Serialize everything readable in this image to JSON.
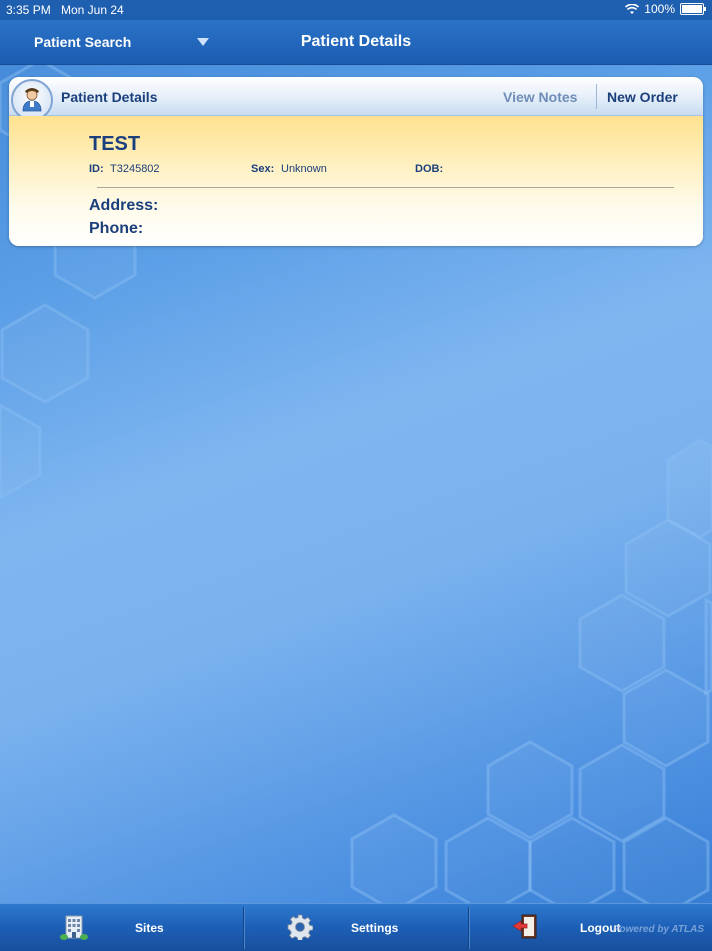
{
  "status_bar": {
    "time": "3:35 PM",
    "date": "Mon Jun 24",
    "battery": "100%",
    "battery_level": 1.0
  },
  "nav": {
    "left_label": "Patient Search",
    "title": "Patient Details"
  },
  "card": {
    "header_title": "Patient Details",
    "view_notes_label": "View Notes",
    "new_order_label": "New Order",
    "patient_name": "TEST",
    "id_label": "ID:",
    "id_value": "T3245802",
    "sex_label": "Sex:",
    "sex_value": "Unknown",
    "dob_label": "DOB:",
    "dob_value": "",
    "address_label": "Address:",
    "phone_label": "Phone:"
  },
  "tabs": [
    {
      "label": "Sites",
      "icon": "building-icon"
    },
    {
      "label": "Settings",
      "icon": "gear-icon"
    },
    {
      "label": "Logout",
      "icon": "logout-door-icon"
    }
  ],
  "watermark": "Powered by ATLAS"
}
